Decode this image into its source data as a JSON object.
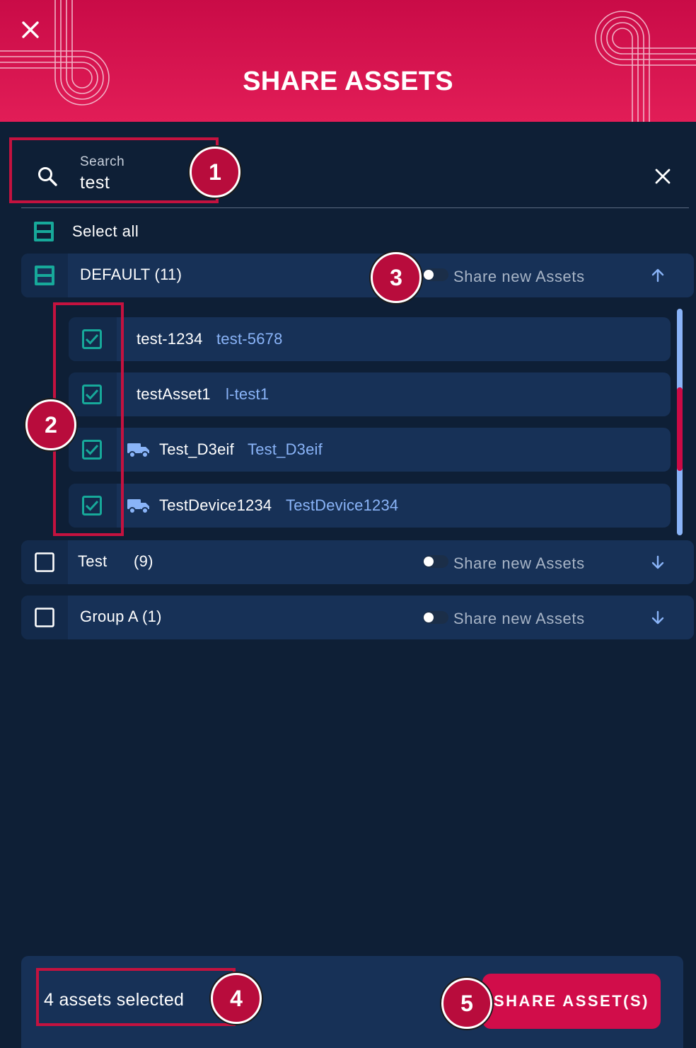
{
  "header": {
    "title": "SHARE ASSETS",
    "close_icon": "close-icon"
  },
  "search": {
    "label": "Search",
    "value": "test",
    "search_icon": "search-icon",
    "clear_icon": "clear-icon"
  },
  "select_all": {
    "label": "Select all",
    "state": "indeterminate"
  },
  "groups": [
    {
      "label": "DEFAULT (11)",
      "count": "",
      "checkbox_state": "indeterminate",
      "share_new_label": "Share new Assets",
      "share_new_enabled": false,
      "expanded": true,
      "assets": [
        {
          "name": "test-1234",
          "id": "test-5678",
          "icon": "",
          "checked": true
        },
        {
          "name": "testAsset1",
          "id": "l-test1",
          "icon": "",
          "checked": true
        },
        {
          "name": "Test_D3eif",
          "id": "Test_D3eif",
          "icon": "truck-icon",
          "checked": true
        },
        {
          "name": "TestDevice1234",
          "id": "TestDevice1234",
          "icon": "truck-icon",
          "checked": true
        }
      ]
    },
    {
      "label": "Test",
      "count": "(9)",
      "checkbox_state": "unchecked",
      "share_new_label": "Share new Assets",
      "share_new_enabled": false,
      "expanded": false
    },
    {
      "label": "Group A (1)",
      "count": "",
      "checkbox_state": "unchecked",
      "share_new_label": "Share new Assets",
      "share_new_enabled": false,
      "expanded": false
    }
  ],
  "footer": {
    "selected_text": "4 assets selected",
    "share_button_label": "SHARE ASSET(S)"
  },
  "callouts": [
    "1",
    "2",
    "3",
    "4",
    "5"
  ],
  "colors": {
    "brand": "#d10d4a",
    "background": "#0e1f36",
    "row": "#173157",
    "link": "#8ab4f8",
    "checkbox": "#17a99a"
  }
}
